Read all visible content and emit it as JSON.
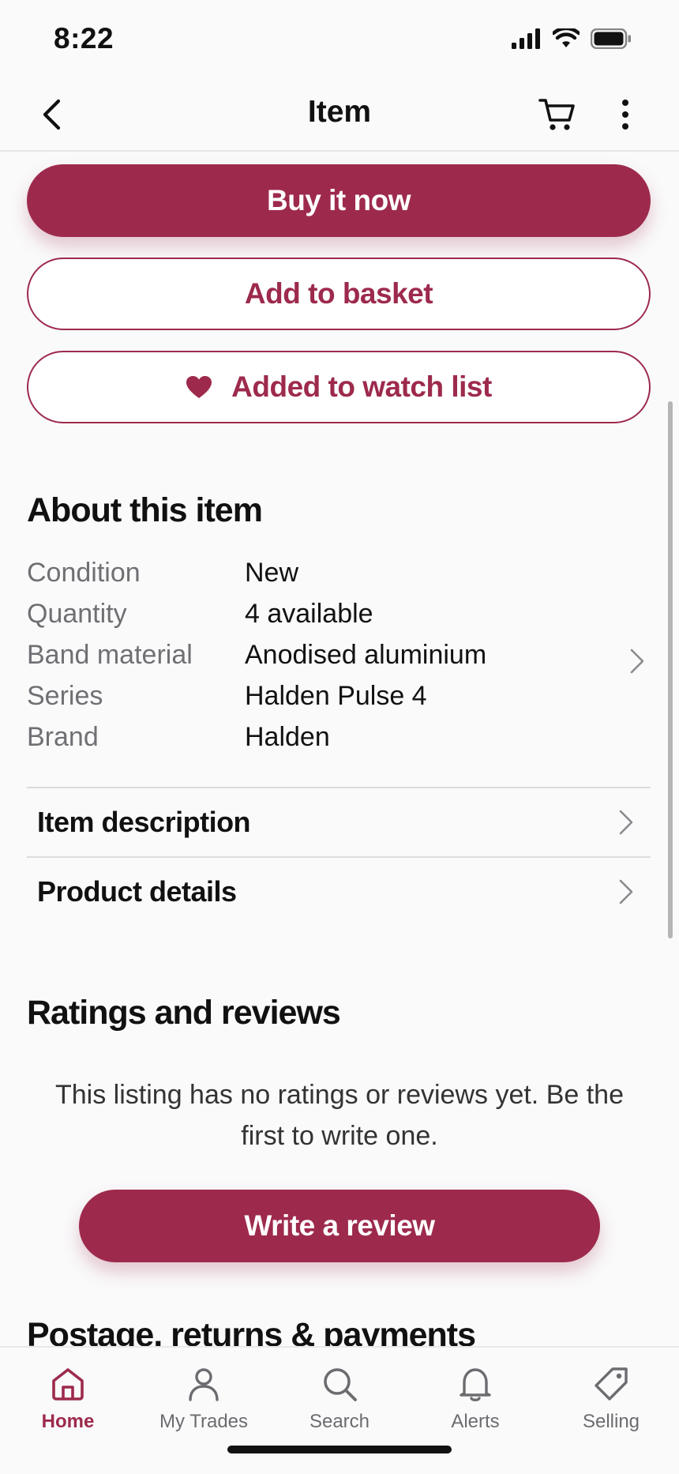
{
  "status": {
    "time": "8:22"
  },
  "nav": {
    "title": "Item"
  },
  "actions": {
    "buy_now": "Buy it now",
    "add_to_basket": "Add to basket",
    "watch_list": "Added to watch list"
  },
  "about": {
    "title": "About this item",
    "specs": [
      {
        "label": "Condition",
        "value": "New"
      },
      {
        "label": "Quantity",
        "value": "4 available"
      },
      {
        "label": "Band material",
        "value": "Anodised aluminium"
      },
      {
        "label": "Series",
        "value": "Halden Pulse 4"
      },
      {
        "label": "Brand",
        "value": "Halden"
      }
    ],
    "links": [
      {
        "label": "Item description"
      },
      {
        "label": "Product details"
      }
    ]
  },
  "reviews": {
    "title": "Ratings and reviews",
    "empty_text": "This listing has no ratings or reviews yet. Be the first to write one.",
    "write_review": "Write a review"
  },
  "postage": {
    "title": "Postage, returns & payments"
  },
  "tabs": [
    {
      "label": "Home",
      "icon": "home-icon",
      "active": true
    },
    {
      "label": "My Trades",
      "icon": "person-icon",
      "active": false
    },
    {
      "label": "Search",
      "icon": "search-icon",
      "active": false
    },
    {
      "label": "Alerts",
      "icon": "bell-icon",
      "active": false
    },
    {
      "label": "Selling",
      "icon": "tag-icon",
      "active": false
    }
  ],
  "colors": {
    "accent": "#9d2a4c",
    "background": "#fafafb"
  }
}
